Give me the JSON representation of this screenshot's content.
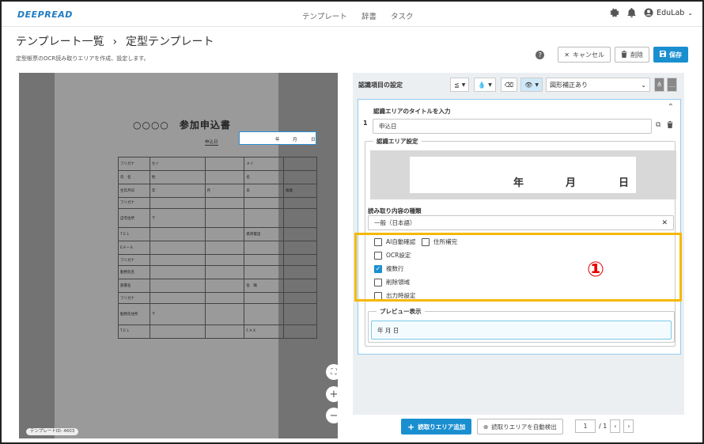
{
  "header": {
    "logo": "DEEPREAD",
    "nav": [
      "テンプレート",
      "辞書",
      "タスク"
    ],
    "user": "EduLab"
  },
  "page": {
    "breadcrumb_parent": "テンプレート一覧",
    "breadcrumb_sep": "›",
    "breadcrumb_current": "定型テンプレート",
    "subtitle": "定型帳票のOCR読み取りエリアを作成、設定します。",
    "help": "?",
    "cancel_label": "キャンセル",
    "delete_label": "削除",
    "save_label": "保存"
  },
  "document": {
    "title": "○○○○　参加申込書",
    "apply_label": "申込日",
    "date_year": "年",
    "date_month": "月",
    "date_day": "日",
    "rows": [
      [
        "フリガナ",
        "セイ",
        "",
        "メイ",
        ""
      ],
      [
        "氏　名",
        "姓",
        "",
        "名",
        ""
      ],
      [
        "生年月日",
        "年",
        "月",
        "日",
        "職業"
      ],
      [
        "フリガナ",
        "",
        "",
        "",
        ""
      ],
      [
        "自宅住所",
        "〒",
        "",
        "",
        ""
      ],
      [
        "T E L",
        "",
        "",
        "携帯電話",
        ""
      ],
      [
        "Eメール",
        "",
        "",
        "",
        ""
      ],
      [
        "フリガナ",
        "",
        "",
        "",
        ""
      ],
      [
        "勤務先名",
        "",
        "",
        "",
        ""
      ],
      [
        "部署名",
        "",
        "",
        "役　職",
        ""
      ],
      [
        "フリガナ",
        "",
        "",
        "",
        ""
      ],
      [
        "勤務先住所",
        "〒",
        "",
        "",
        ""
      ],
      [
        "T E L",
        "",
        "",
        "F A X",
        ""
      ]
    ],
    "template_id": "テンプレートID: 4603"
  },
  "panel": {
    "settings_title": "認識項目の設定",
    "tool_compare": "≦",
    "correction_option": "図形補正あり",
    "item_number": "1",
    "area_title_heading": "認識エリアのタイトルを入力",
    "area_title_value": "申込日",
    "area_setting_legend": "認識エリア設定",
    "crop_year": "年",
    "crop_month": "月",
    "crop_day": "日",
    "read_type_label": "読み取り内容の種類",
    "read_type_value": "一般（日本語）",
    "options": [
      {
        "label": "AI自動確認",
        "checked": false
      },
      {
        "label": "住所補完",
        "checked": false
      },
      {
        "label": "OCR設定",
        "checked": false
      },
      {
        "label": "複数行",
        "checked": true
      },
      {
        "label": "削除領域",
        "checked": false
      },
      {
        "label": "出力時設定",
        "checked": false
      }
    ],
    "preview_legend": "プレビュー表示",
    "preview_value": "年 月 日",
    "annotation": "①",
    "add_area_label": "読取りエリア追加",
    "auto_detect_label": "読取りエリアを自動検出",
    "page_current": "1",
    "page_total": "/ 1"
  },
  "colors": {
    "accent": "#1a8fd0",
    "highlight": "#f5b800",
    "annotation": "#e60000",
    "viewer_bg": "#737373"
  }
}
